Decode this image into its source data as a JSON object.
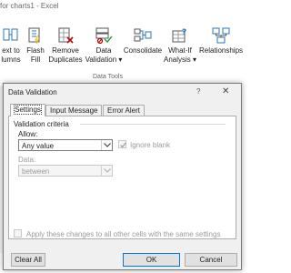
{
  "window_title": "for charts1 - Excel",
  "ribbon": {
    "buttons": [
      {
        "label": "ext to",
        "label2": "lumns",
        "icon": "text-to-columns-icon"
      },
      {
        "label": "Flash",
        "label2": "Fill",
        "icon": "flash-fill-icon"
      },
      {
        "label": "Remove",
        "label2": "Duplicates",
        "icon": "remove-duplicates-icon"
      },
      {
        "label": "Data",
        "label2": "Validation ▾",
        "icon": "data-validation-icon"
      },
      {
        "label": "Consolidate",
        "label2": "",
        "icon": "consolidate-icon"
      },
      {
        "label": "What-If",
        "label2": "Analysis ▾",
        "icon": "what-if-icon"
      },
      {
        "label": "Relationships",
        "label2": "",
        "icon": "relationships-icon"
      }
    ],
    "group_label": "Data Tools"
  },
  "dialog": {
    "title": "Data Validation",
    "help": "?",
    "close": "✕",
    "tabs": [
      "Settings",
      "Input Message",
      "Error Alert"
    ],
    "active_tab": "Settings",
    "criteria_title": "Validation criteria",
    "allow_label": "Allow:",
    "allow_value": "Any value",
    "ignore_blank_label": "Ignore blank",
    "ignore_blank_checked": true,
    "data_label": "Data:",
    "data_value": "between",
    "apply_all_label": "Apply these changes to all other cells with the same settings",
    "apply_all_checked": false,
    "buttons": {
      "clear_all": "Clear All",
      "ok": "OK",
      "cancel": "Cancel"
    }
  },
  "colors": {
    "ok_border": "#0078d7",
    "dialog_bg": "#f0f0f0",
    "icon_blue": "#2e75b6",
    "icon_red": "#c00000"
  }
}
